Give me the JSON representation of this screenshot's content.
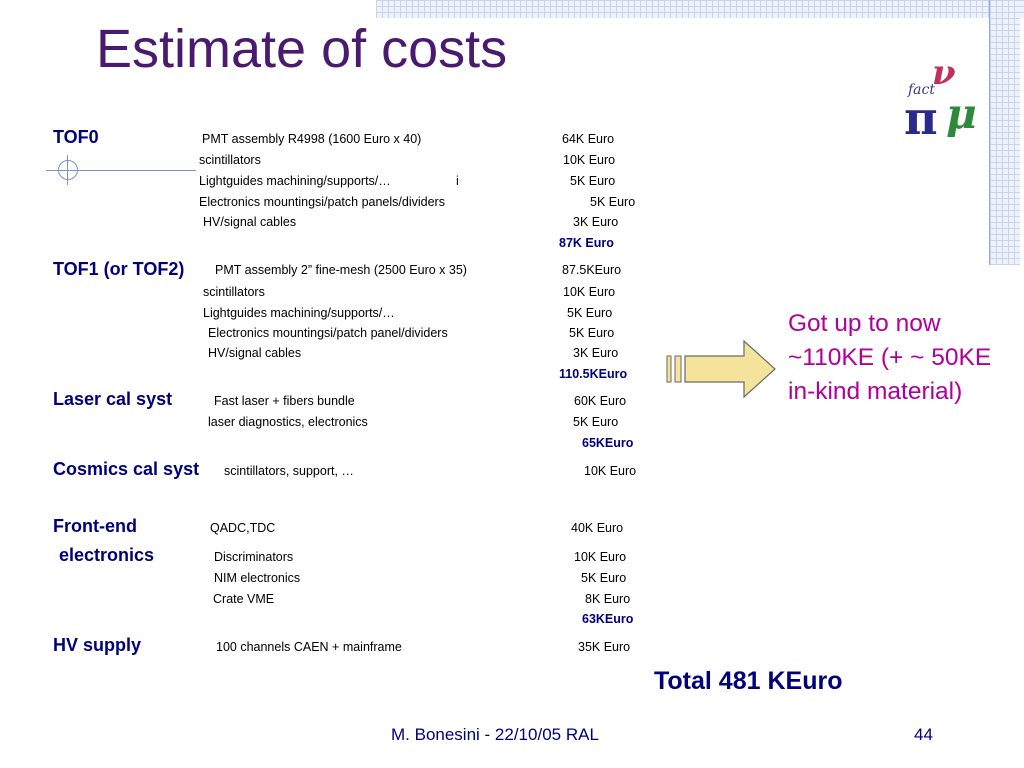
{
  "title": "Estimate of costs",
  "logo": {
    "text": "fact",
    "icon": "nu-mu-pi-logo-icon"
  },
  "sections": {
    "tof0": {
      "heading": "TOF0",
      "items": [
        {
          "label": "PMT assembly R4998   (1600 Euro x 40)",
          "cost": "64K Euro"
        },
        {
          "label": "scintillators",
          "cost": "10K Euro"
        },
        {
          "label": "Lightguides machining/supports/…",
          "extra": "i",
          "cost": "5K Euro"
        },
        {
          "label": "Electronics mountingsi/patch panels/dividers",
          "cost": "5K Euro"
        },
        {
          "label": "HV/signal cables",
          "cost": "3K Euro"
        }
      ],
      "subtotal": "87K Euro"
    },
    "tof1": {
      "heading": "TOF1 (or TOF2)",
      "items": [
        {
          "label": "PMT assembly 2” fine-mesh (2500 Euro x 35)",
          "cost": "87.5KEuro"
        },
        {
          "label": "scintillators",
          "cost": "10K    Euro"
        },
        {
          "label": "Lightguides machining/supports/…",
          "cost": "5K     Euro"
        },
        {
          "label": "Electronics mountingsi/patch panel/dividers",
          "cost": "5K    Euro"
        },
        {
          "label": "HV/signal cables",
          "cost": "3K     Euro"
        }
      ],
      "subtotal": "110.5KEuro"
    },
    "laser": {
      "heading": "Laser cal syst",
      "items": [
        {
          "label": "Fast laser  + fibers bundle",
          "cost": "60K Euro"
        },
        {
          "label": "laser diagnostics, electronics",
          "cost": "5K   Euro"
        }
      ],
      "subtotal": "65KEuro"
    },
    "cosmics": {
      "heading": "Cosmics cal syst",
      "items": [
        {
          "label": "scintillators, support, …",
          "cost": "10K Euro"
        }
      ]
    },
    "frontend": {
      "heading_line1": "Front-end",
      "heading_line2": "electronics",
      "items": [
        {
          "label": "QADC,TDC",
          "cost": "40K Euro"
        },
        {
          "label": "Discriminators",
          "cost": "10K  Euro"
        },
        {
          "label": "NIM electronics",
          "cost": "5K   Euro"
        },
        {
          "label": "Crate VME",
          "cost": "8K   Euro"
        }
      ],
      "subtotal": "63KEuro"
    },
    "hv": {
      "heading": "HV supply",
      "items": [
        {
          "label": "100 channels CAEN + mainframe",
          "cost": "35K Euro"
        }
      ]
    }
  },
  "note": "Got up to now ~110KE (+ ~ 50KE in-kind material)",
  "total": "Total  481 KEuro",
  "footer": {
    "author": "M. Bonesini - 22/10/05 RAL",
    "page": "44"
  },
  "colors": {
    "title": "#4a1a6e",
    "heading": "#00007a",
    "note": "#b0009a",
    "arrow_fill": "#f4e39a"
  }
}
